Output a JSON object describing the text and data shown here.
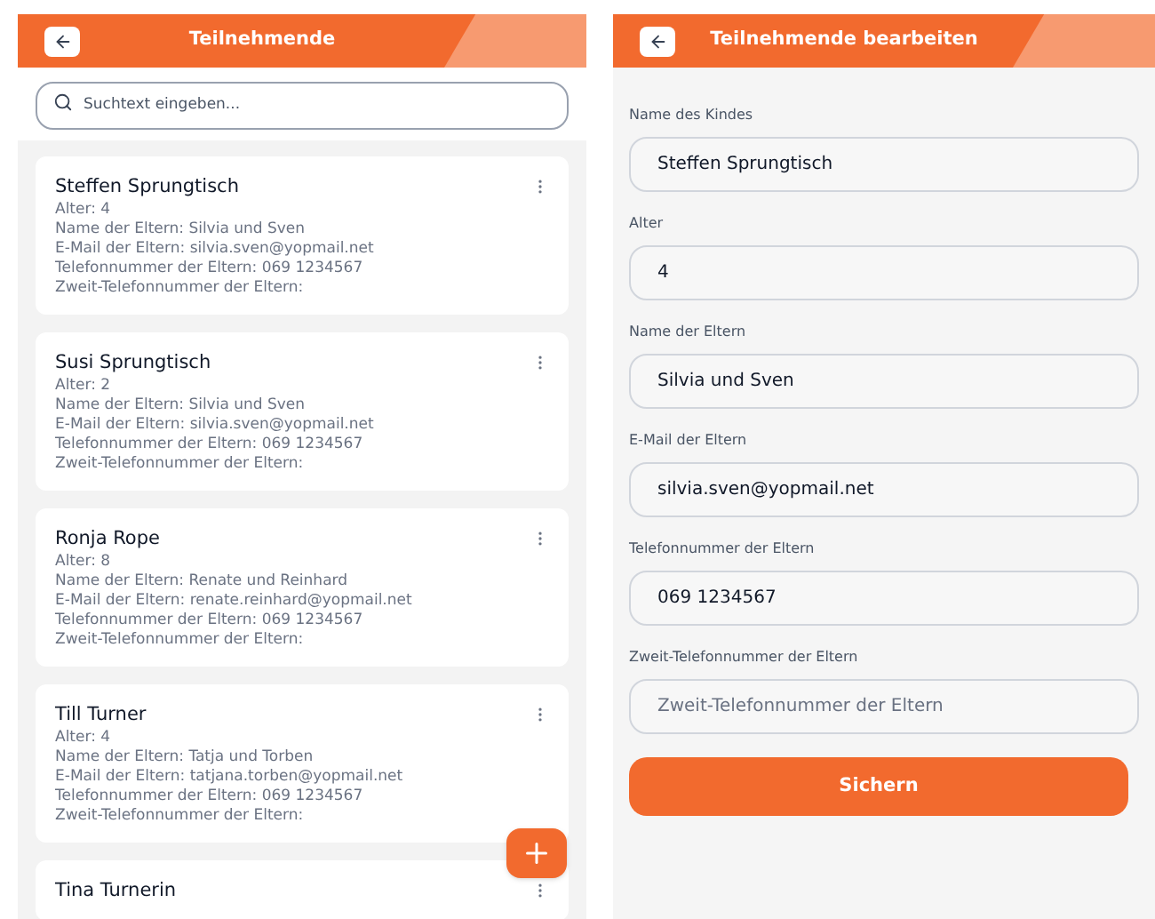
{
  "list_screen": {
    "title": "Teilnehmende",
    "search": {
      "placeholder": "Suchtext eingeben..."
    },
    "participants": [
      {
        "name": "Steffen Sprungtisch",
        "details": [
          "Alter: 4",
          "Name der Eltern: Silvia und Sven",
          "E-Mail der Eltern: silvia.sven@yopmail.net",
          "Telefonnummer der Eltern: 069 1234567",
          "Zweit-Telefonnummer der Eltern:"
        ]
      },
      {
        "name": "Susi Sprungtisch",
        "details": [
          "Alter: 2",
          "Name der Eltern: Silvia und Sven",
          "E-Mail der Eltern: silvia.sven@yopmail.net",
          "Telefonnummer der Eltern: 069 1234567",
          "Zweit-Telefonnummer der Eltern:"
        ]
      },
      {
        "name": "Ronja Rope",
        "details": [
          "Alter: 8",
          "Name der Eltern: Renate und Reinhard",
          "E-Mail der Eltern: renate.reinhard@yopmail.net",
          "Telefonnummer der Eltern: 069 1234567",
          "Zweit-Telefonnummer der Eltern:"
        ]
      },
      {
        "name": "Till Turner",
        "details": [
          "Alter: 4",
          "Name der Eltern: Tatja und Torben",
          "E-Mail der Eltern: tatjana.torben@yopmail.net",
          "Telefonnummer der Eltern: 069 1234567",
          "Zweit-Telefonnummer der Eltern:"
        ]
      },
      {
        "name": "Tina Turnerin"
      }
    ]
  },
  "edit_screen": {
    "title": "Teilnehmende bearbeiten",
    "fields": [
      {
        "label": "Name des Kindes",
        "value": "Steffen Sprungtisch"
      },
      {
        "label": "Alter",
        "value": "4"
      },
      {
        "label": "Name der Eltern",
        "value": "Silvia und Sven"
      },
      {
        "label": "E-Mail der Eltern",
        "value": "silvia.sven@yopmail.net"
      },
      {
        "label": "Telefonnummer der Eltern",
        "value": "069 1234567"
      },
      {
        "label": "Zweit-Telefonnummer der Eltern",
        "placeholder": "Zweit-Telefonnummer der Eltern"
      }
    ],
    "save_button": "Sichern"
  }
}
